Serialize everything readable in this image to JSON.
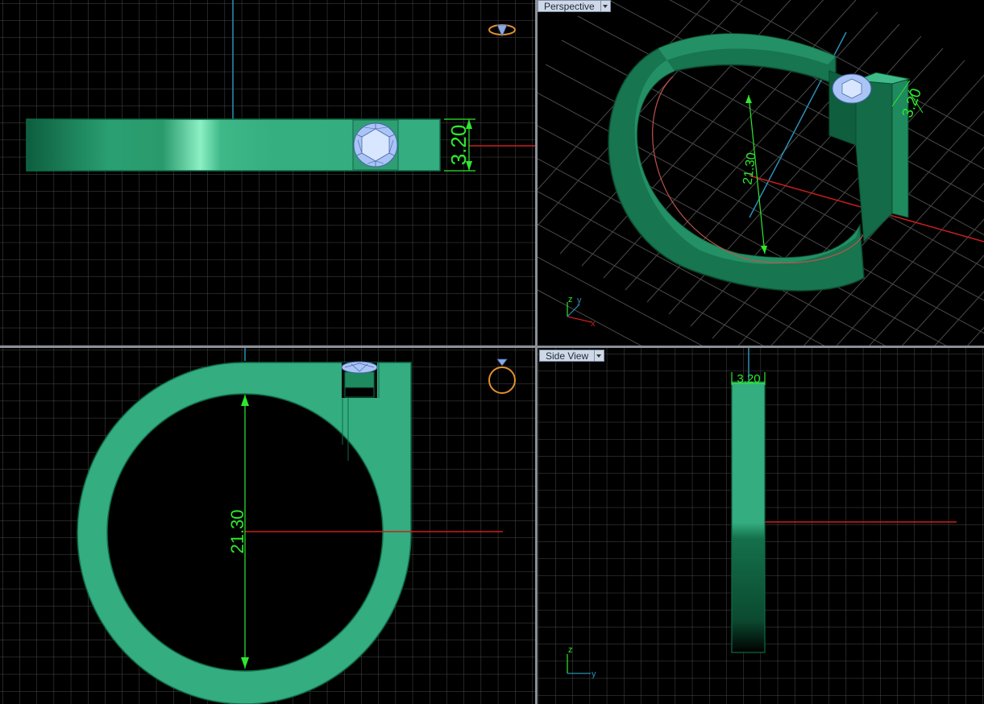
{
  "viewports": {
    "top": {
      "name": ""
    },
    "perspective": {
      "name": "Perspective"
    },
    "front": {
      "name": ""
    },
    "side": {
      "name": "Side View"
    }
  },
  "dimensions": {
    "width": "3.20",
    "inner_diameter": "21.30"
  },
  "axes": {
    "x": "x",
    "y": "y",
    "z": "z"
  },
  "colors": {
    "metal": "#34ad80",
    "metal_dark": "#0d5e3e",
    "gem": "#a9c4f5",
    "grid": "#4a4a4a",
    "x_axis": "#cc1e1e",
    "y_axis": "#2b8fb8",
    "dimension": "#2ee82e"
  }
}
